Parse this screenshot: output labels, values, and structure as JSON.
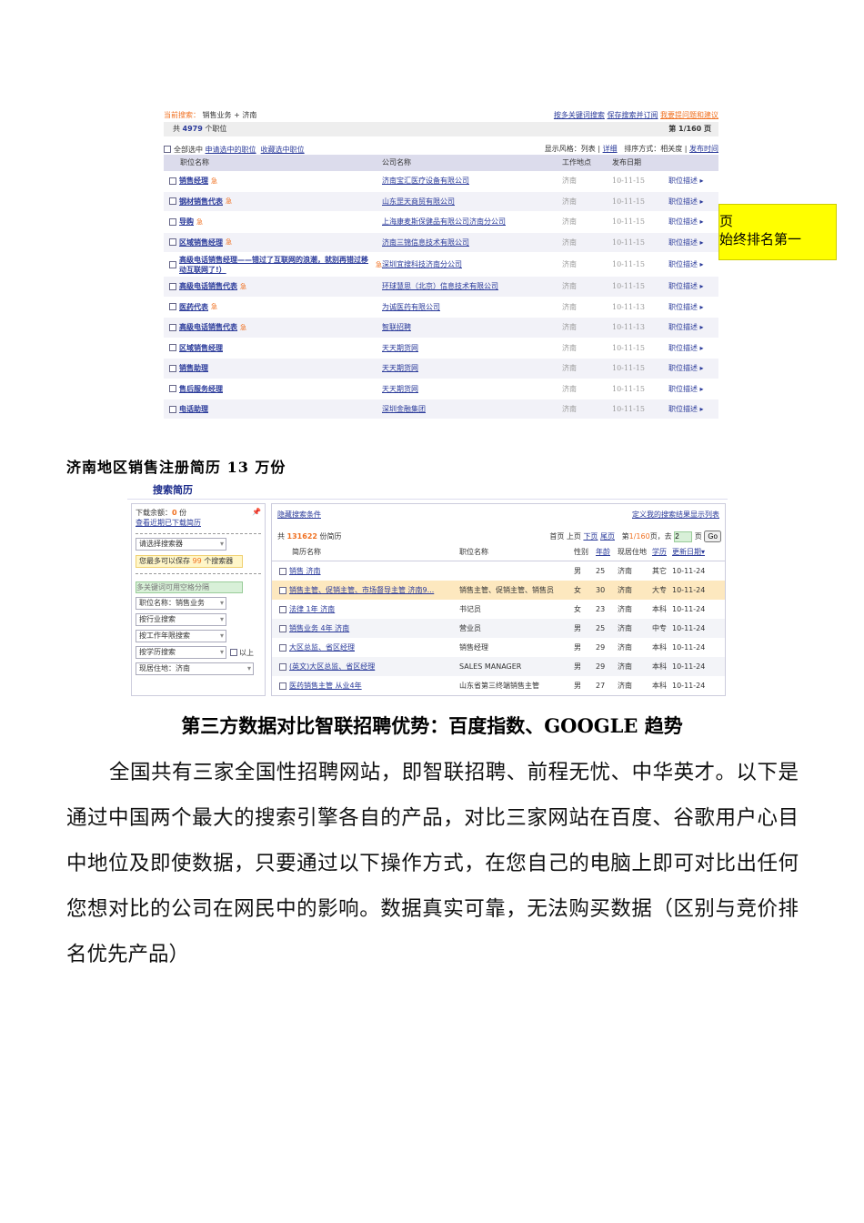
{
  "shot1": {
    "current_search_label": "当前搜索：",
    "current_search": "销售业务 + 济南",
    "links": [
      "按多关键词搜索",
      "保存搜索并订阅",
      "我要提问题和建议"
    ],
    "total_prefix": "共",
    "total": "4979",
    "total_suffix": "个职位",
    "page": "第 1/160 页",
    "select_all": "全部选中",
    "apply": "申请选中的职位",
    "favorite": "收藏选中职位",
    "display_style": "显示风格：列表",
    "detail": "详细",
    "sort": "排序方式：相关度",
    "sort_time": "发布时间",
    "headers": [
      "职位名称",
      "公司名称",
      "工作地点",
      "发布日期"
    ],
    "hot": "急",
    "rows": [
      {
        "title": "销售经理",
        "company": "济南宝汇医疗设备有限公司",
        "loc": "济南",
        "date": "10-11-15",
        "hot": true
      },
      {
        "title": "钢材销售代表",
        "company": "山东罡天商贸有限公司",
        "loc": "济南",
        "date": "10-11-15",
        "hot": true
      },
      {
        "title": "导购",
        "company": "上海康麦斯保健品有限公司济南分公司",
        "loc": "济南",
        "date": "10-11-15",
        "hot": true
      },
      {
        "title": "区域销售经理",
        "company": "济南三锦信息技术有限公司",
        "loc": "济南",
        "date": "10-11-15",
        "hot": true
      },
      {
        "title": "高级电话销售经理——错过了互联网的浪潮，就别再错过移动互联网了!）",
        "company": "深圳宜搜科技济南分公司",
        "loc": "济南",
        "date": "10-11-15",
        "hot": true
      },
      {
        "title": "高级电话销售代表",
        "company": "环球慧思（北京）信息技术有限公司",
        "loc": "济南",
        "date": "10-11-15",
        "hot": true
      },
      {
        "title": "医药代表",
        "company": "为诚医药有限公司",
        "loc": "济南",
        "date": "10-11-13",
        "hot": true
      },
      {
        "title": "高级电话销售代表",
        "company": "智联招聘",
        "loc": "济南",
        "date": "10-11-13",
        "hot": true
      },
      {
        "title": "区域销售经理",
        "company": "天天期货网",
        "loc": "济南",
        "date": "10-11-15",
        "hot": false
      },
      {
        "title": "销售助理",
        "company": "天天期货网",
        "loc": "济南",
        "date": "10-11-15",
        "hot": false
      },
      {
        "title": "售后服务经理",
        "company": "天天期货网",
        "loc": "济南",
        "date": "10-11-15",
        "hot": false
      },
      {
        "title": "电话助理",
        "company": "深圳金融集团",
        "loc": "济南",
        "date": "10-11-15",
        "hot": false
      }
    ],
    "desc_link": "职位描述 ▸"
  },
  "note": {
    "line1": "页",
    "line2": "始终排名第一"
  },
  "heading1": "济南地区销售注册简历 13 万份",
  "shot2": {
    "title": "搜索简历",
    "download_label": "下载余额：",
    "download_count": "0",
    "download_unit": "份",
    "recent_link": "查看近期已下载简历",
    "select_searcher": "请选择搜索器",
    "save_tip_a": "您最多可以保存",
    "save_tip_n": "99",
    "save_tip_b": "个搜索器",
    "keyword_placeholder": "多关键词可用空格分隔",
    "job_name": "职位名称：销售业务",
    "industry": "按行业搜索",
    "years": "按工作年限搜索",
    "education": "按学历搜索",
    "above": "以上",
    "residence": "现居住地：济南",
    "hide_link": "隐藏搜索条件",
    "define_link": "定义我的搜索结果显示列表",
    "total_prefix": "共",
    "total": "131622",
    "total_suffix": "份简历",
    "pager": {
      "first": "首页",
      "prev": "上页",
      "next": "下页",
      "last": "尾页",
      "page_prefix": "第",
      "page": "1/160",
      "page_suffix": "页，去",
      "goto": "2",
      "unit": "页",
      "go": "Go"
    },
    "headers": [
      "简历名称",
      "职位名称",
      "性别",
      "年龄",
      "现居住地",
      "学历",
      "更新日期▾"
    ],
    "rows": [
      {
        "name": "销售 济南",
        "job": "",
        "sex": "男",
        "age": "25",
        "loc": "济南",
        "edu": "其它",
        "date": "10-11-24"
      },
      {
        "name": "销售主管、促销主管、市场督导主管 济南9...",
        "job": "销售主管、促销主管、销售员",
        "sex": "女",
        "age": "30",
        "loc": "济南",
        "edu": "大专",
        "date": "10-11-24"
      },
      {
        "name": "法律 1年 济南",
        "job": "书记员",
        "sex": "女",
        "age": "23",
        "loc": "济南",
        "edu": "本科",
        "date": "10-11-24"
      },
      {
        "name": "销售业务 4年 济南",
        "job": "营业员",
        "sex": "男",
        "age": "25",
        "loc": "济南",
        "edu": "中专",
        "date": "10-11-24"
      },
      {
        "name": "大区总监、省区经理",
        "job": "销售经理",
        "sex": "男",
        "age": "29",
        "loc": "济南",
        "edu": "本科",
        "date": "10-11-24"
      },
      {
        "name": "(英文)大区总监、省区经理",
        "job": "SALES MANAGER",
        "sex": "男",
        "age": "29",
        "loc": "济南",
        "edu": "本科",
        "date": "10-11-24"
      },
      {
        "name": "医药销售主管 从业4年",
        "job": "山东省第三终端销售主管",
        "sex": "男",
        "age": "27",
        "loc": "济南",
        "edu": "本科",
        "date": "10-11-24"
      }
    ]
  },
  "heading2": "第三方数据对比智联招聘优势：百度指数、GOOGLE 趋势",
  "paragraph": "全国共有三家全国性招聘网站，即智联招聘、前程无忧、中华英才。以下是通过中国两个最大的搜索引擎各自的产品，对比三家网站在百度、谷歌用户心目中地位及即使数据，只要通过以下操作方式，在您自己的电脑上即可对比出任何您想对比的公司在网民中的影响。数据真实可靠，无法购买数据（区别与竞价排名优先产品）"
}
